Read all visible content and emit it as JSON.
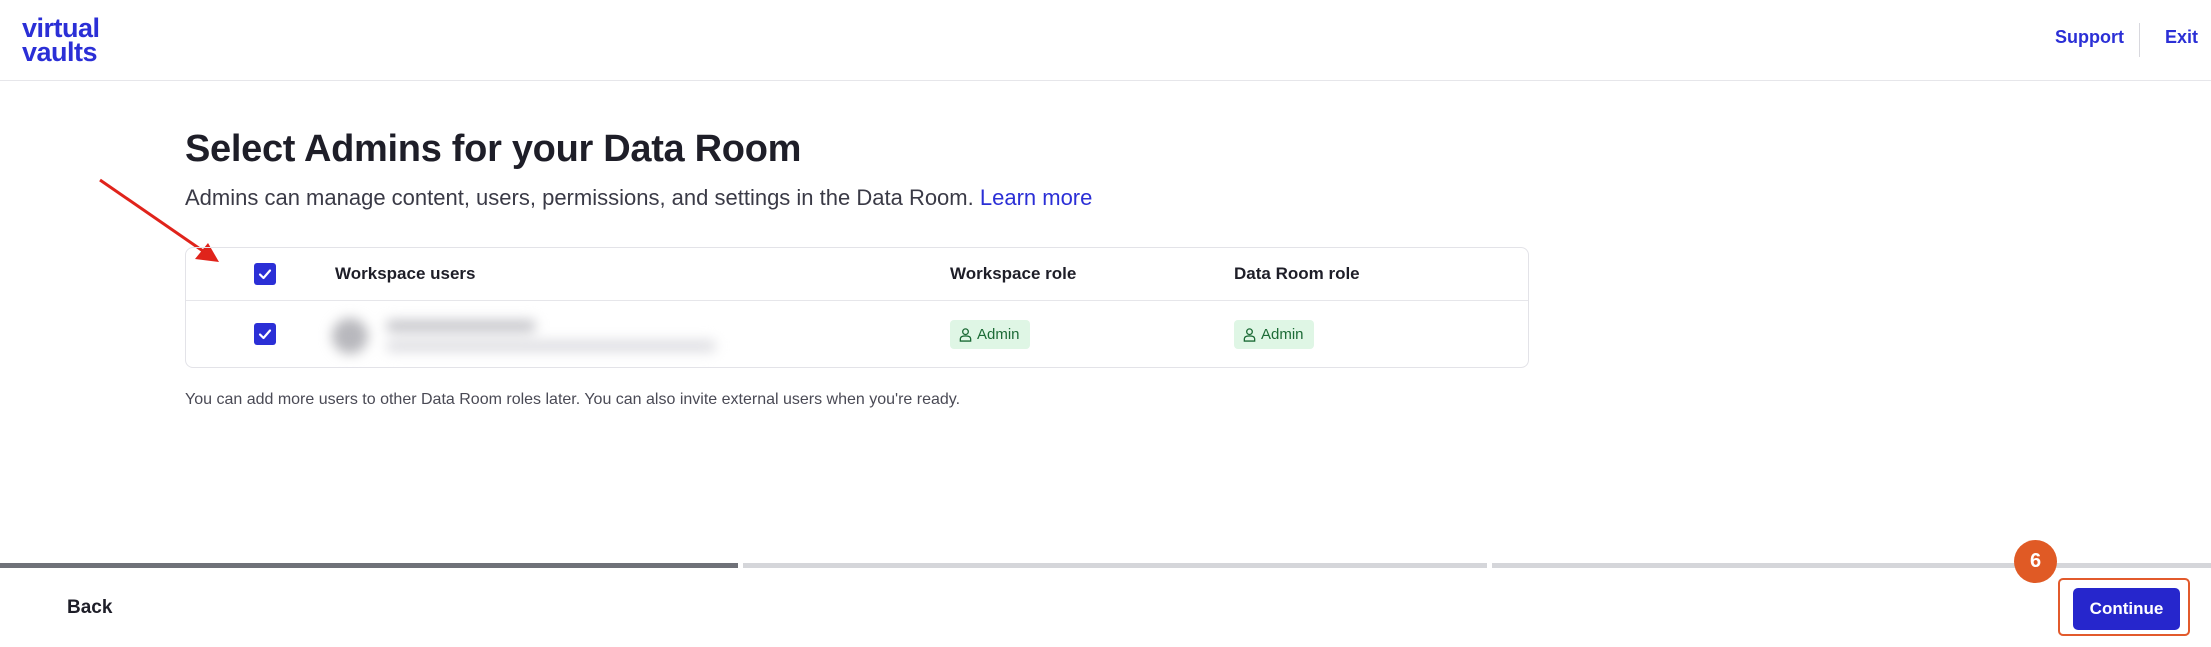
{
  "app": {
    "logo_line1": "virtual",
    "logo_line2": "vaults"
  },
  "header": {
    "support_label": "Support",
    "exit_label": "Exit"
  },
  "main": {
    "title": "Select Admins for your Data Room",
    "subtitle": "Admins can manage content, users, permissions, and settings in the Data Room. ",
    "learn_more": "Learn more",
    "helper_text": "You can add more users to other Data Room roles later. You can also invite external users when you're ready."
  },
  "table": {
    "columns": {
      "users": "Workspace users",
      "workspace_role": "Workspace role",
      "dataroom_role": "Data Room role"
    },
    "select_all_checked": true,
    "rows": [
      {
        "checked": true,
        "workspace_role": "Admin",
        "dataroom_role": "Admin"
      }
    ]
  },
  "progress": {
    "steps_total": 3,
    "steps_completed": 1
  },
  "footer": {
    "back_label": "Back",
    "continue_label": "Continue",
    "step_badge": "6"
  },
  "colors": {
    "accent": "#2b2fd6",
    "badge_bg": "#dff6e5",
    "badge_text": "#1c6b36",
    "annotation": "#e05a25"
  }
}
